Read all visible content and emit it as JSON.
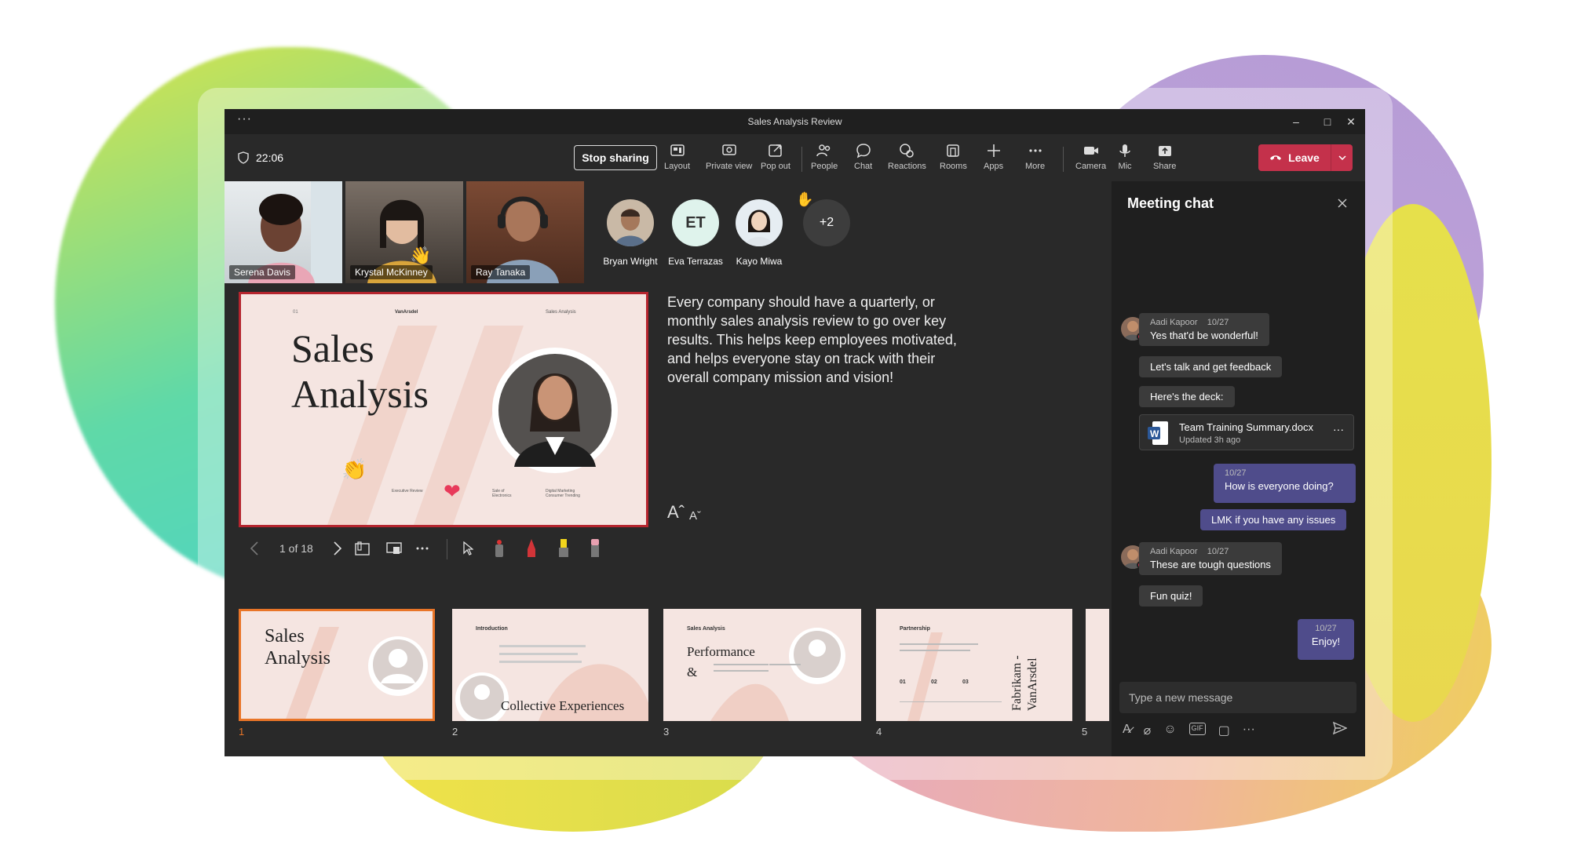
{
  "window": {
    "title": "Sales Analysis Review",
    "menu_dots": "···",
    "minimize": "–",
    "maximize": "□",
    "close": "✕"
  },
  "toolbar": {
    "timer": "22:06",
    "stop_sharing": "Stop sharing",
    "items": [
      {
        "label": "Layout",
        "icon": "layout-icon"
      },
      {
        "label": "Private view",
        "icon": "private-view-icon"
      },
      {
        "label": "Pop out",
        "icon": "pop-out-icon"
      },
      {
        "label": "People",
        "icon": "people-icon"
      },
      {
        "label": "Chat",
        "icon": "chat-icon"
      },
      {
        "label": "Reactions",
        "icon": "reactions-icon"
      },
      {
        "label": "Rooms",
        "icon": "rooms-icon"
      },
      {
        "label": "Apps",
        "icon": "apps-icon"
      },
      {
        "label": "More",
        "icon": "more-icon"
      },
      {
        "label": "Camera",
        "icon": "camera-icon"
      },
      {
        "label": "Mic",
        "icon": "mic-icon"
      },
      {
        "label": "Share",
        "icon": "share-icon"
      }
    ],
    "leave": "Leave"
  },
  "participants": {
    "video": [
      "Serena Davis",
      "Krystal McKinney",
      "Ray Tanaka"
    ],
    "avatars": [
      {
        "name": "Bryan Wright",
        "initials": ""
      },
      {
        "name": "Eva Terrazas",
        "initials": "ET"
      },
      {
        "name": "Kayo Miwa",
        "initials": ""
      }
    ],
    "overflow": "+2"
  },
  "slide": {
    "title_line1": "Sales",
    "title_line2": "Analysis",
    "header_left": "01",
    "header_mid": "VanArsdel",
    "header_right": "Sales Analysis",
    "foot": [
      "Executive Review",
      "Sale of Electronics",
      "Digital Marketing Consumer Trending"
    ]
  },
  "description": "Every company should have a quarterly, or monthly sales analysis review to go over key results. This helps keep employees motivated, and helps everyone stay on track with their overall company mission and vision!",
  "font_controls": {
    "increase": "Aˆ",
    "decrease": "Aˇ"
  },
  "slide_nav": {
    "position": "1 of 18"
  },
  "thumbnails": [
    {
      "num": "1",
      "title1": "Sales",
      "title2": "Analysis"
    },
    {
      "num": "2",
      "heading": "Introduction",
      "title1": "Collective Experiences"
    },
    {
      "num": "3",
      "heading": "Sales Analysis",
      "title1": "Performance",
      "title2": "&"
    },
    {
      "num": "4",
      "heading": "Partnership",
      "title1": "Fabrikam -",
      "title2": "VanArsdel",
      "stats": [
        "01",
        "02",
        "03"
      ]
    },
    {
      "num": "5"
    }
  ],
  "chat": {
    "title": "Meeting chat",
    "messages": [
      {
        "author": "Aadi Kapoor",
        "time": "10/27",
        "text": "Yes that'd be wonderful!"
      },
      {
        "text": "Let's talk and get feedback"
      },
      {
        "text": "Here's the deck:"
      },
      {
        "file_name": "Team Training Summary.docx",
        "file_meta": "Updated 3h ago",
        "file_more": "···"
      },
      {
        "time": "10/27",
        "text": "How is everyone doing?"
      },
      {
        "text": "LMK if you have any issues"
      },
      {
        "author": "Aadi Kapoor",
        "time": "10/27",
        "text": "These are tough questions"
      },
      {
        "text": "Fun quiz!"
      },
      {
        "time": "10/27",
        "text": "Enjoy!"
      }
    ],
    "input_placeholder": "Type a new message"
  },
  "colors": {
    "accent": "#c4314b",
    "self_bubble": "#4f4c8b",
    "selected_thumb": "#e97528"
  }
}
